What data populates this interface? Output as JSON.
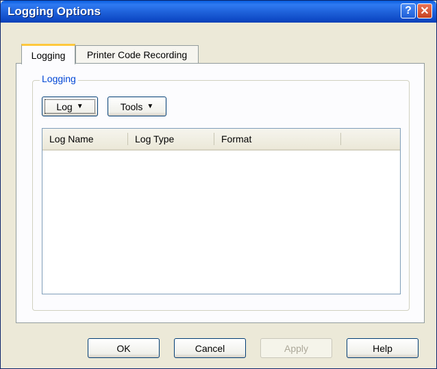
{
  "window": {
    "title": "Logging Options",
    "help_glyph": "?",
    "close_glyph": "✕"
  },
  "tabs": [
    {
      "label": "Logging",
      "active": true
    },
    {
      "label": "Printer Code Recording",
      "active": false
    }
  ],
  "group": {
    "label": "Logging",
    "log_button": {
      "label": "Log",
      "arrow": "▼"
    },
    "tools_button": {
      "label": "Tools",
      "arrow": "▼"
    },
    "list": {
      "columns": [
        "Log Name",
        "Log Type",
        "Format"
      ],
      "rows": []
    }
  },
  "buttons": {
    "ok": "OK",
    "cancel": "Cancel",
    "apply": "Apply",
    "help": "Help"
  }
}
